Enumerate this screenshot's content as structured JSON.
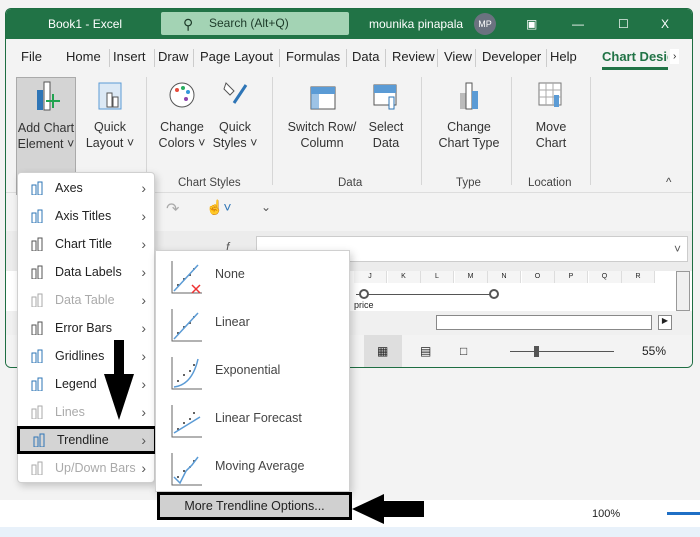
{
  "window": {
    "title": "Book1 - Excel",
    "search_placeholder": "Search (Alt+Q)",
    "user": "mounika pinapala",
    "avatar": "MP",
    "minimize": "—",
    "maximize": "☐",
    "close": "X"
  },
  "tabs": [
    "File",
    "Home",
    "Insert",
    "Draw",
    "Page Layout",
    "Formulas",
    "Data",
    "Review",
    "View",
    "Developer",
    "Help",
    "Chart Design"
  ],
  "ribbon": {
    "buttons": [
      {
        "l1": "Add Chart",
        "l2": "Element ˅"
      },
      {
        "l1": "Quick",
        "l2": "Layout ˅"
      },
      {
        "l1": "Change",
        "l2": "Colors ˅"
      },
      {
        "l1": "Quick",
        "l2": "Styles ˅"
      },
      {
        "l1": "Switch Row/",
        "l2": "Column"
      },
      {
        "l1": "Select",
        "l2": "Data"
      },
      {
        "l1": "Change",
        "l2": "Chart Type"
      },
      {
        "l1": "Move",
        "l2": "Chart"
      }
    ],
    "groups": [
      "Chart Styles",
      "Data",
      "Type",
      "Location"
    ]
  },
  "grid": {
    "columns": [
      "J",
      "K",
      "L",
      "M",
      "N",
      "O",
      "P",
      "Q",
      "R"
    ],
    "cell_text": "price"
  },
  "status": {
    "zoom": "55%",
    "zoom_outer": "100%"
  },
  "menu": {
    "items": [
      {
        "label": "Axes",
        "enabled": true
      },
      {
        "label": "Axis Titles",
        "enabled": true
      },
      {
        "label": "Chart Title",
        "enabled": true
      },
      {
        "label": "Data Labels",
        "enabled": true
      },
      {
        "label": "Data Table",
        "enabled": false
      },
      {
        "label": "Error Bars",
        "enabled": true
      },
      {
        "label": "Gridlines",
        "enabled": true
      },
      {
        "label": "Legend",
        "enabled": true
      },
      {
        "label": "Lines",
        "enabled": false
      },
      {
        "label": "Trendline",
        "enabled": true,
        "selected": true
      },
      {
        "label": "Up/Down Bars",
        "enabled": false
      }
    ]
  },
  "submenu": {
    "items": [
      "None",
      "Linear",
      "Exponential",
      "Linear Forecast",
      "Moving Average"
    ],
    "more": "More Trendline Options..."
  },
  "colors": {
    "accent": "#217346",
    "highlight": "#d4d4d4"
  }
}
